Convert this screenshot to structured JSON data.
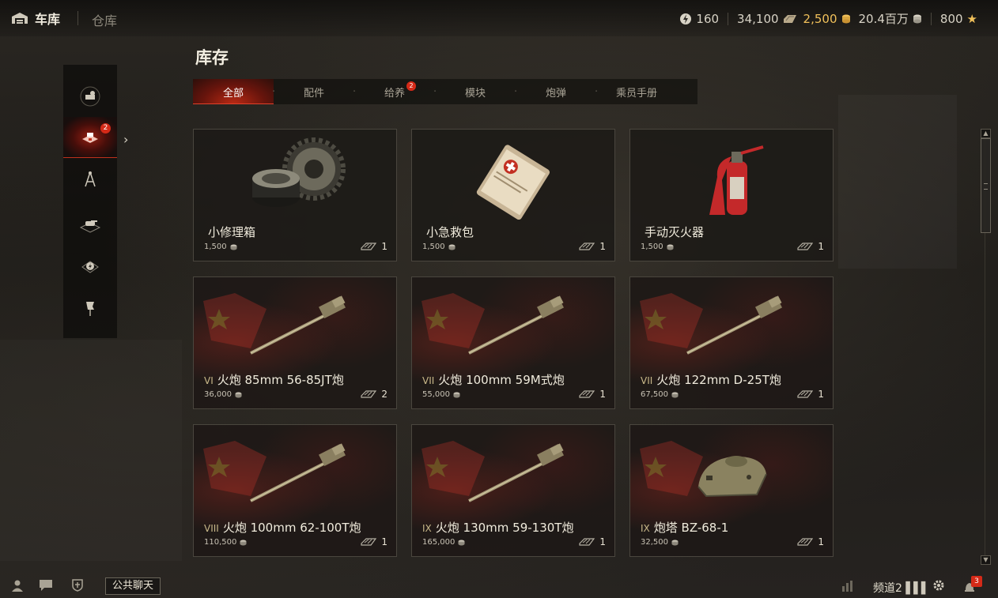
{
  "topbar": {
    "garage_label": "车库",
    "depot_label": "仓库",
    "resources": {
      "free_xp": "160",
      "credits_bonds": "34,100",
      "gold": "2,500",
      "credits": "20.4百万",
      "stars": "800"
    }
  },
  "page": {
    "title": "库存",
    "tabs": [
      {
        "label": "全部",
        "active": true
      },
      {
        "label": "配件"
      },
      {
        "label": "给养",
        "badge": "2"
      },
      {
        "label": "模块"
      },
      {
        "label": "炮弹"
      },
      {
        "label": "乘员手册"
      }
    ]
  },
  "sidemenu": {
    "items": [
      {
        "icon": "equipment-icon"
      },
      {
        "icon": "consumables-icon",
        "active": true,
        "badge": "2"
      },
      {
        "icon": "compass-icon"
      },
      {
        "icon": "vehicle-shells-icon"
      },
      {
        "icon": "boosters-icon"
      },
      {
        "icon": "flag-icon"
      }
    ]
  },
  "items": [
    {
      "tier": "",
      "name": "小修理箱",
      "price": "1,500",
      "count": "1",
      "kind": "repair"
    },
    {
      "tier": "",
      "name": "小急救包",
      "price": "1,500",
      "count": "1",
      "kind": "firstaid"
    },
    {
      "tier": "",
      "name": "手动灭火器",
      "price": "1,500",
      "count": "1",
      "kind": "extinguisher"
    },
    {
      "tier": "VI",
      "name": "火炮 85mm 56-85JT炮",
      "price": "36,000",
      "count": "2",
      "kind": "gun"
    },
    {
      "tier": "VII",
      "name": "火炮 100mm 59M式炮",
      "price": "55,000",
      "count": "1",
      "kind": "gun"
    },
    {
      "tier": "VII",
      "name": "火炮 122mm D-25T炮",
      "price": "67,500",
      "count": "1",
      "kind": "gun"
    },
    {
      "tier": "VIII",
      "name": "火炮 100mm 62-100T炮",
      "price": "110,500",
      "count": "1",
      "kind": "gun"
    },
    {
      "tier": "IX",
      "name": "火炮 130mm 59-130T炮",
      "price": "165,000",
      "count": "1",
      "kind": "gun"
    },
    {
      "tier": "IX",
      "name": "炮塔 BZ-68-1",
      "price": "32,500",
      "count": "1",
      "kind": "turret"
    }
  ],
  "bottombar": {
    "chat_label": "公共聊天",
    "channel_label": "频道2",
    "notifications": "3"
  },
  "colors": {
    "accent_red": "#d52a18",
    "gold": "#f0c05a",
    "card_border": "#4a463e"
  }
}
